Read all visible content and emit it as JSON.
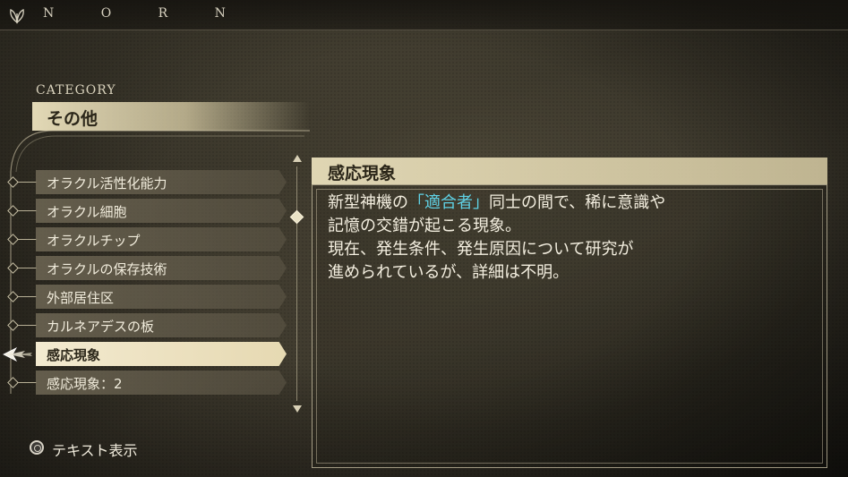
{
  "app": {
    "brand": "N O R N"
  },
  "category": {
    "heading": "CATEGORY",
    "value": "その他"
  },
  "list": {
    "items": [
      {
        "label": "オラクル活性化能力",
        "selected": false
      },
      {
        "label": "オラクル細胞",
        "selected": false
      },
      {
        "label": "オラクルチップ",
        "selected": false
      },
      {
        "label": "オラクルの保存技術",
        "selected": false
      },
      {
        "label": "外部居住区",
        "selected": false
      },
      {
        "label": "カルネアデスの板",
        "selected": false
      },
      {
        "label": "感応現象",
        "selected": true
      },
      {
        "label": "感応現象：2",
        "selected": false
      }
    ]
  },
  "detail": {
    "title": "感応現象",
    "line1_pre": "新型神機の",
    "line1_highlight": "「適合者」",
    "line1_post": "同士の間で、稀に意識や",
    "line2": "記憶の交錯が起こる現象。",
    "line3": "現在、発生条件、発生原因について研究が",
    "line4": "進められているが、詳細は不明。",
    "highlight_color": "#5fd2e6"
  },
  "footer": {
    "button_icon": "circle-button-icon",
    "hint_label": "テキスト表示"
  }
}
